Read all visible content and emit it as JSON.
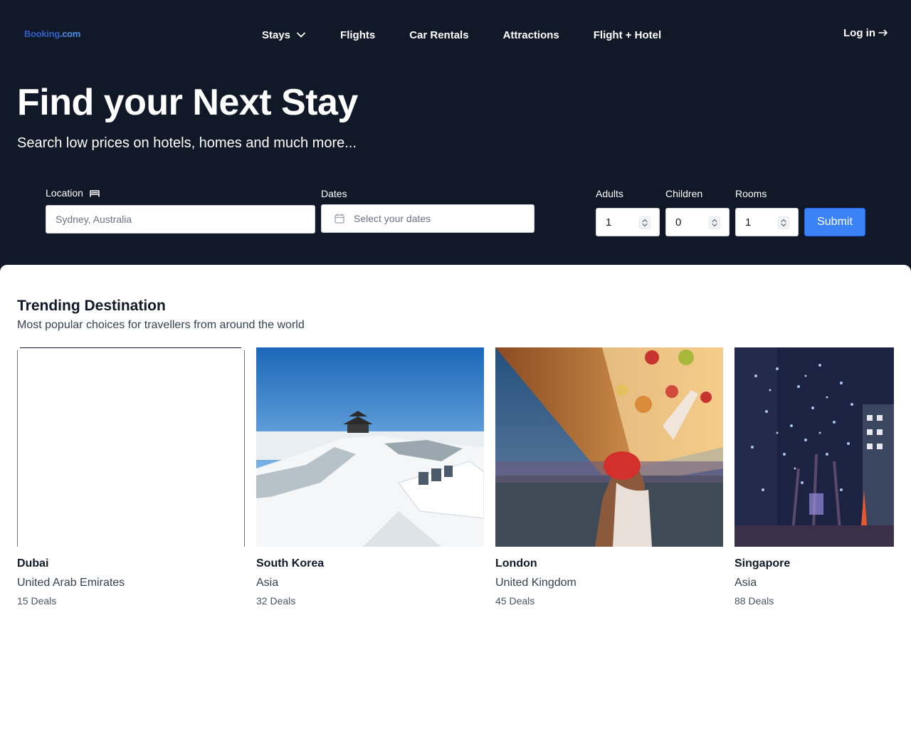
{
  "brand": {
    "part1": "Booking",
    "part2": ".com"
  },
  "nav": {
    "items": [
      {
        "label": "Stays",
        "has_dropdown": true
      },
      {
        "label": "Flights"
      },
      {
        "label": "Car Rentals"
      },
      {
        "label": "Attractions"
      },
      {
        "label": "Flight + Hotel"
      }
    ],
    "login": "Log in",
    "login_icon": "arrow-right-icon"
  },
  "hero": {
    "title": "Find your Next Stay",
    "subtitle": "Search low prices on hotels, homes and much more..."
  },
  "search": {
    "location_label": "Location",
    "location_icon": "bed-icon",
    "location_placeholder": "Sydney, Australia",
    "dates_label": "Dates",
    "dates_placeholder": "Select your dates",
    "adults_label": "Adults",
    "adults_value": "1",
    "children_label": "Children",
    "children_value": "0",
    "rooms_label": "Rooms",
    "rooms_value": "1",
    "submit_label": "Submit"
  },
  "trending": {
    "title": "Trending Destination",
    "subtitle": "Most popular choices for travellers from around the world",
    "cards": [
      {
        "name": "Dubai",
        "region": "United Arab Emirates",
        "deals": "15 Deals"
      },
      {
        "name": "South Korea",
        "region": "Asia",
        "deals": "32 Deals"
      },
      {
        "name": "London",
        "region": "United Kingdom",
        "deals": "45 Deals"
      },
      {
        "name": "Singapore",
        "region": "Asia",
        "deals": "88 Deals"
      }
    ]
  },
  "colors": {
    "header_bg": "#111827",
    "accent": "#3b82f6",
    "brand_blue": "#2f5fc4"
  }
}
